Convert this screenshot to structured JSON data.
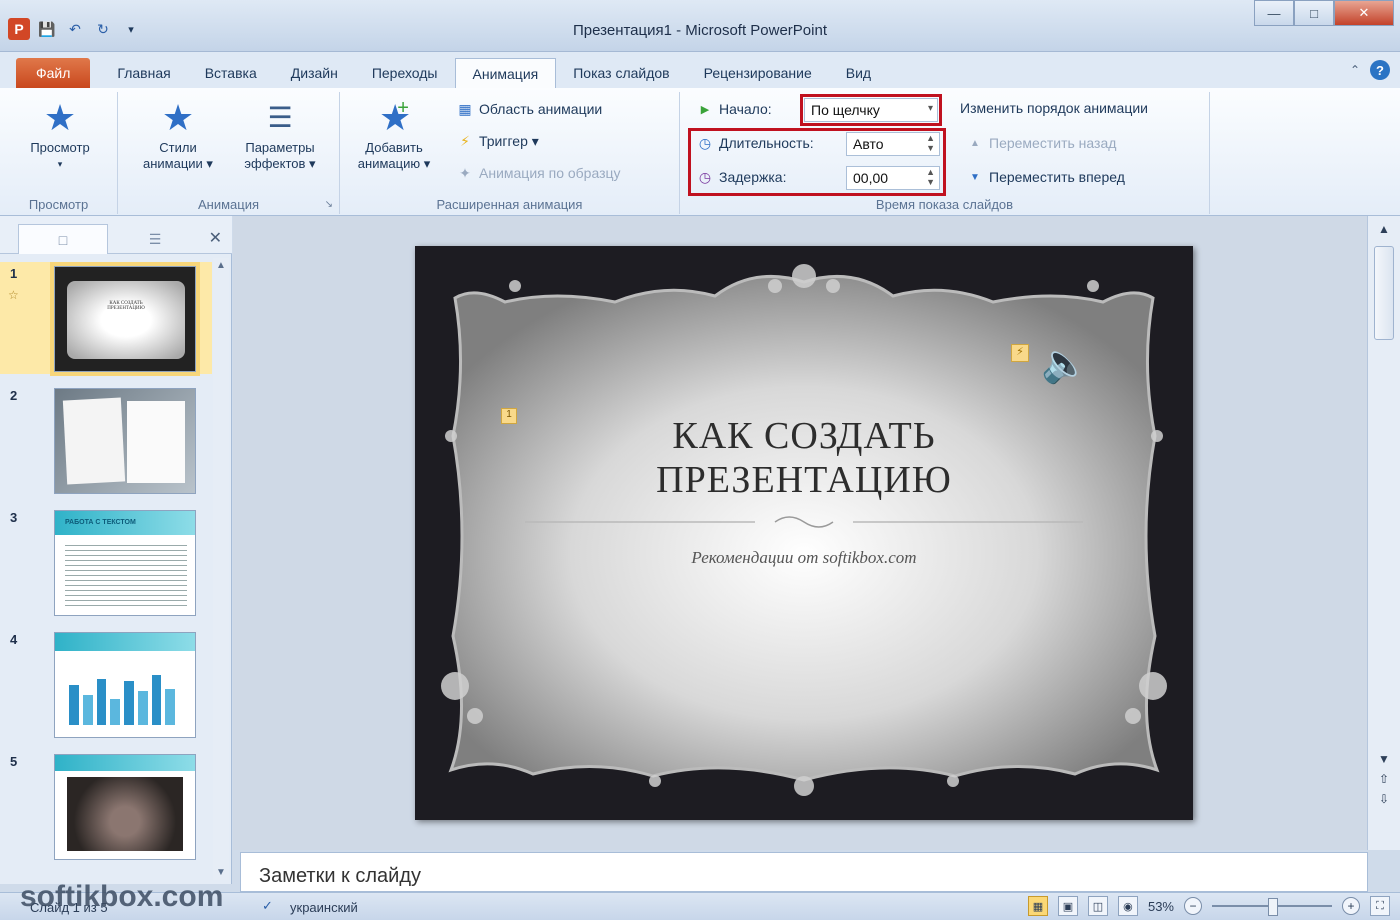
{
  "window": {
    "title": "Презентация1 - Microsoft PowerPoint",
    "app_letter": "P"
  },
  "tabs": [
    "Файл",
    "Главная",
    "Вставка",
    "Дизайн",
    "Переходы",
    "Анимация",
    "Показ слайдов",
    "Рецензирование",
    "Вид"
  ],
  "active_tab": "Анимация",
  "ribbon": {
    "preview_group": {
      "button": "Просмотр",
      "label": "Просмотр"
    },
    "animation_group": {
      "styles": "Стили анимации ▾",
      "effects": "Параметры эффектов ▾",
      "label": "Анимация"
    },
    "advanced_group": {
      "add": "Добавить анимацию ▾",
      "pane": "Область анимации",
      "trigger": "Триггер ▾",
      "painter": "Анимация по образцу",
      "label": "Расширенная анимация"
    },
    "timing_group": {
      "start_label": "Начало:",
      "start_value": "По щелчку",
      "duration_label": "Длительность:",
      "duration_value": "Авто",
      "delay_label": "Задержка:",
      "delay_value": "00,00",
      "reorder_title": "Изменить порядок анимации",
      "move_back": "Переместить назад",
      "move_forward": "Переместить вперед",
      "label": "Время показа слайдов"
    }
  },
  "slides": [
    {
      "num": "1",
      "thumb_title": "КАК СОЗДАТЬ ПРЕЗЕНТАЦИЮ"
    },
    {
      "num": "2"
    },
    {
      "num": "3",
      "thumb_title": "РАБОТА С ТЕКСТОМ"
    },
    {
      "num": "4"
    },
    {
      "num": "5"
    }
  ],
  "slide": {
    "title_line1": "КАК СОЗДАТЬ",
    "title_line2": "ПРЕЗЕНТАЦИЮ",
    "subtitle": "Рекомендации от softikbox.com",
    "anim_marker": "1"
  },
  "notes": {
    "placeholder": "Заметки к слайду"
  },
  "status": {
    "slide_info": "Слайд 1 из 5",
    "language": "украинский",
    "zoom": "53%"
  },
  "watermark": "softikbox.com",
  "colors": {
    "file_tab": "#c9481e",
    "highlight_red": "#c0111f",
    "accent_blue": "#2f6fc6"
  }
}
